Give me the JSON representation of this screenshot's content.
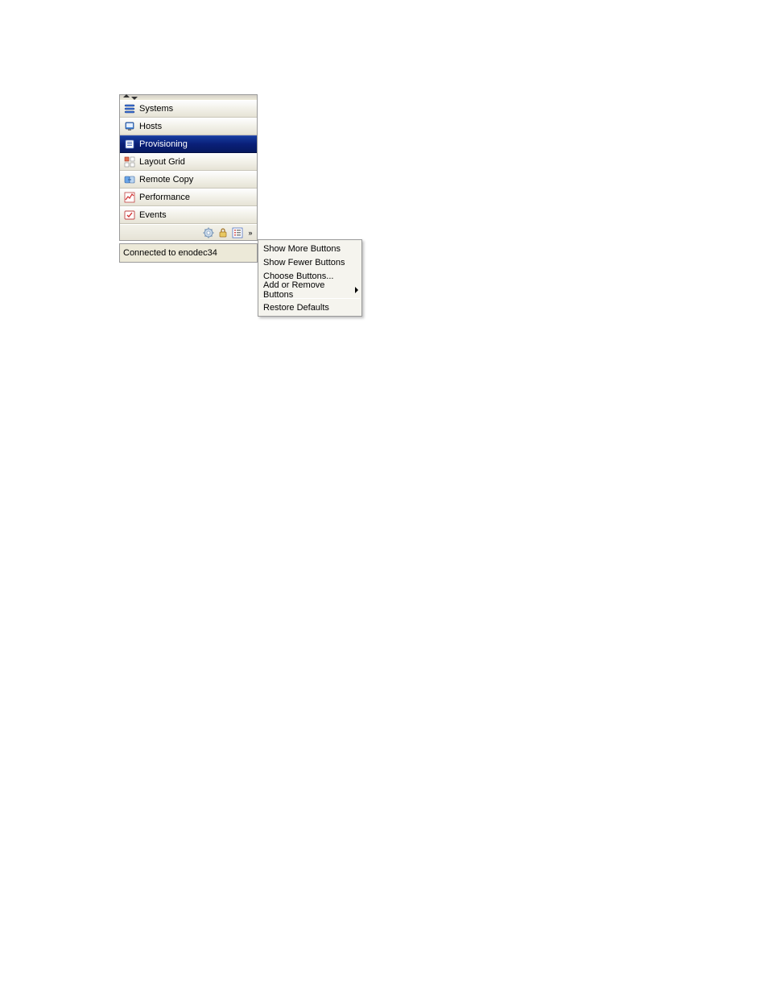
{
  "navigation": {
    "items": [
      {
        "label": "Systems",
        "icon": "systems-icon",
        "selected": false
      },
      {
        "label": "Hosts",
        "icon": "hosts-icon",
        "selected": false
      },
      {
        "label": "Provisioning",
        "icon": "provisioning-icon",
        "selected": true
      },
      {
        "label": "Layout Grid",
        "icon": "layout-grid-icon",
        "selected": false
      },
      {
        "label": "Remote Copy",
        "icon": "remote-copy-icon",
        "selected": false
      },
      {
        "label": "Performance",
        "icon": "performance-icon",
        "selected": false
      },
      {
        "label": "Events",
        "icon": "events-icon",
        "selected": false
      }
    ],
    "button_bar_icons": [
      "gear-icon",
      "lock-icon",
      "list-icon"
    ]
  },
  "status": {
    "text": "Connected to enodec34"
  },
  "context_menu": {
    "items": [
      {
        "label": "Show More Buttons",
        "has_submenu": false
      },
      {
        "label": "Show Fewer Buttons",
        "has_submenu": false
      },
      {
        "label": "Choose Buttons...",
        "has_submenu": false
      },
      {
        "label": "Add or Remove Buttons",
        "has_submenu": true
      }
    ],
    "footer_items": [
      {
        "label": "Restore Defaults",
        "has_submenu": false
      }
    ]
  }
}
